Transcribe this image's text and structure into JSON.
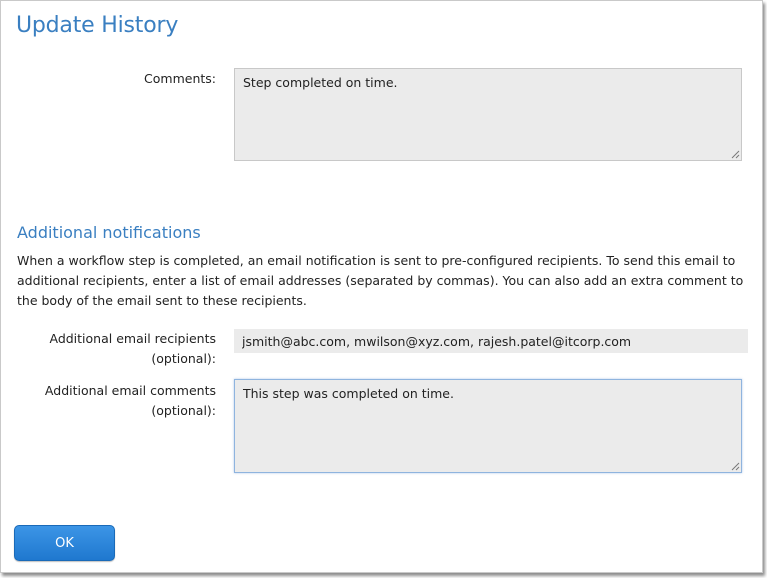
{
  "dialog": {
    "title": "Update History"
  },
  "comments": {
    "label": "Comments:",
    "value": "Step completed on time."
  },
  "notifications": {
    "heading": "Additional notifications",
    "description": "When a workflow step is completed, an email notification is sent to pre-configured recipients. To send this email to additional recipients, enter a list of email addresses (separated by commas). You can also add an extra comment to the body of the email sent to these recipients.",
    "recipients_label_line1": "Additional email recipients",
    "recipients_label_line2": "(optional):",
    "recipients_value": "jsmith@abc.com, mwilson@xyz.com, rajesh.patel@itcorp.com",
    "comments_label_line1": "Additional email comments",
    "comments_label_line2": "(optional):",
    "comments_value": "This step was completed on time."
  },
  "actions": {
    "ok_label": "OK"
  },
  "colors": {
    "accent": "#3a7fc1",
    "button": "#2583db",
    "field_background": "#ebebeb",
    "focus_border": "#8fb4de"
  },
  "icons": {
    "resize_grip": "resize-grip-icon"
  }
}
